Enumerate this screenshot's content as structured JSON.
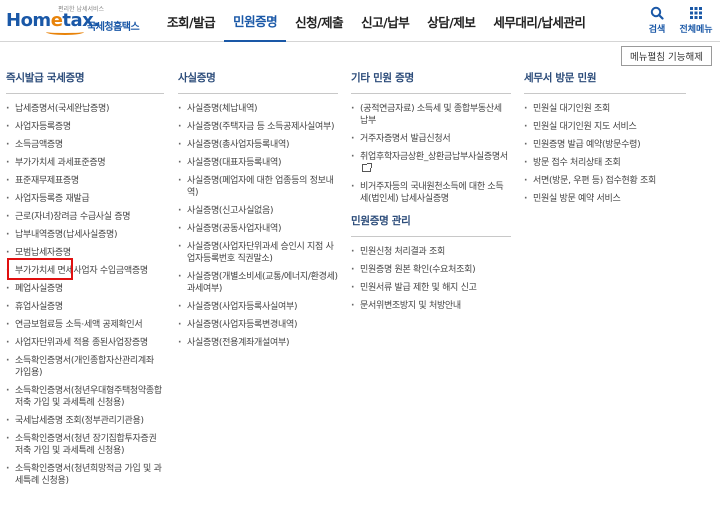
{
  "header": {
    "logo_small": "편리한 납세서비스",
    "logo_main_1": "Hom",
    "logo_main_e": "e",
    "logo_main_2": "tax.",
    "logo_kor": "국세청홈택스",
    "nav": [
      "조회/발급",
      "민원증명",
      "신청/제출",
      "신고/납부",
      "상담/제보",
      "세무대리/납세관리"
    ],
    "active_index": 1,
    "search_label": "검색",
    "all_menu_label": "전체메뉴"
  },
  "toolbar": {
    "unfix_label": "메뉴펼침 기능해제"
  },
  "columns": {
    "col1": {
      "title": "즉시발급 국세증명",
      "items": [
        "납세증명서(국세완납증명)",
        "사업자등록증명",
        "소득금액증명",
        "부가가치세 과세표준증명",
        "표준재무제표증명",
        "사업자등록증 재발급",
        "근로(자녀)장려금 수급사실 증명",
        "납부내역증명(납세사실증명)",
        "모범납세자증명",
        "부가가치세 면세사업자 수입금액증명",
        "폐업사실증명",
        "휴업사실증명",
        "연금보험료등 소득·세액 공제확인서",
        "사업자단위과세 적용 종된사업장증명",
        "소득확인증명서(개인종합자산관리계좌 가입용)",
        "소득확인증명서(청년우대형주택청약종합저축 가입 및 과세특례 신청용)",
        "국세납세증명 조회(정부관리기관용)",
        "소득확인증명서(청년 장기집합투자증권저축 가입 및 과세특례 신청용)",
        "소득확인증명서(청년희망적금 가입 및 과세특례 신청용)"
      ]
    },
    "col2": {
      "title": "사실증명",
      "items": [
        "사실증명(체납내역)",
        "사실증명(주택자금 등 소득공제사실여부)",
        "사실증명(총사업자등록내역)",
        "사실증명(대표자등록내역)",
        "사실증명(폐업자에 대한 업종등의 정보내역)",
        "사실증명(신고사실없음)",
        "사실증명(공동사업자내역)",
        "사실증명(사업자단위과세 승인시 지점 사업자등록번호 직권말소)",
        "사실증명(개별소비세(교통/에너지/환경세)과세여부)",
        "사실증명(사업자등록사실여부)",
        "사실증명(사업자등록변경내역)",
        "사실증명(전용계좌개설여부)"
      ]
    },
    "col3": {
      "title": "기타 민원 증명",
      "items": [
        "(공적연금자료) 소득세 및 종합부동산세 납부",
        "거주자증명서 발급신청서",
        "취업후학자금상환_상환금납부사실증명서",
        "비거주자등의 국내원천소득에 대한 소득세(법인세) 납세사실증명"
      ],
      "sub_title": "민원증명 관리",
      "sub_items": [
        "민원신청 처리결과 조회",
        "민원증명 원본 확인(수요처조회)",
        "민원서류 발급 제한 및 해지 신고",
        "문서위변조방지 및 처방안내"
      ]
    },
    "col4": {
      "title": "세무서 방문 민원",
      "items": [
        "민원실 대기인원 조회",
        "민원실 대기인원 지도 서비스",
        "민원증명 발급 예약(방문수령)",
        "방문 접수 처리상태 조회",
        "서면(방문, 우편 등) 접수현황 조회",
        "민원실 방문 예약 서비스"
      ]
    }
  }
}
